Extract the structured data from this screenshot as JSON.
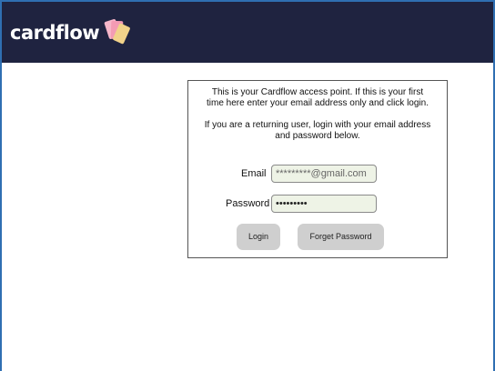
{
  "header": {
    "logo_text": "cardflow",
    "background": "#1f2340"
  },
  "login": {
    "intro_line1": "This is your Cardflow access point. If this is your first",
    "intro_line2": "time here enter your email address only and click login.",
    "returning_line1": "If you are a returning user, login with your email address",
    "returning_line2": "and password below.",
    "email_label": "Email",
    "email_value": "*********@gmail.com",
    "password_label": "Password",
    "password_value": "•••••••••",
    "login_button": "Login",
    "forgot_button": "Forget Password"
  },
  "colors": {
    "accent": "#2f6fb2",
    "button": "#cfcfcf",
    "field_bg": "#eef3e6"
  }
}
